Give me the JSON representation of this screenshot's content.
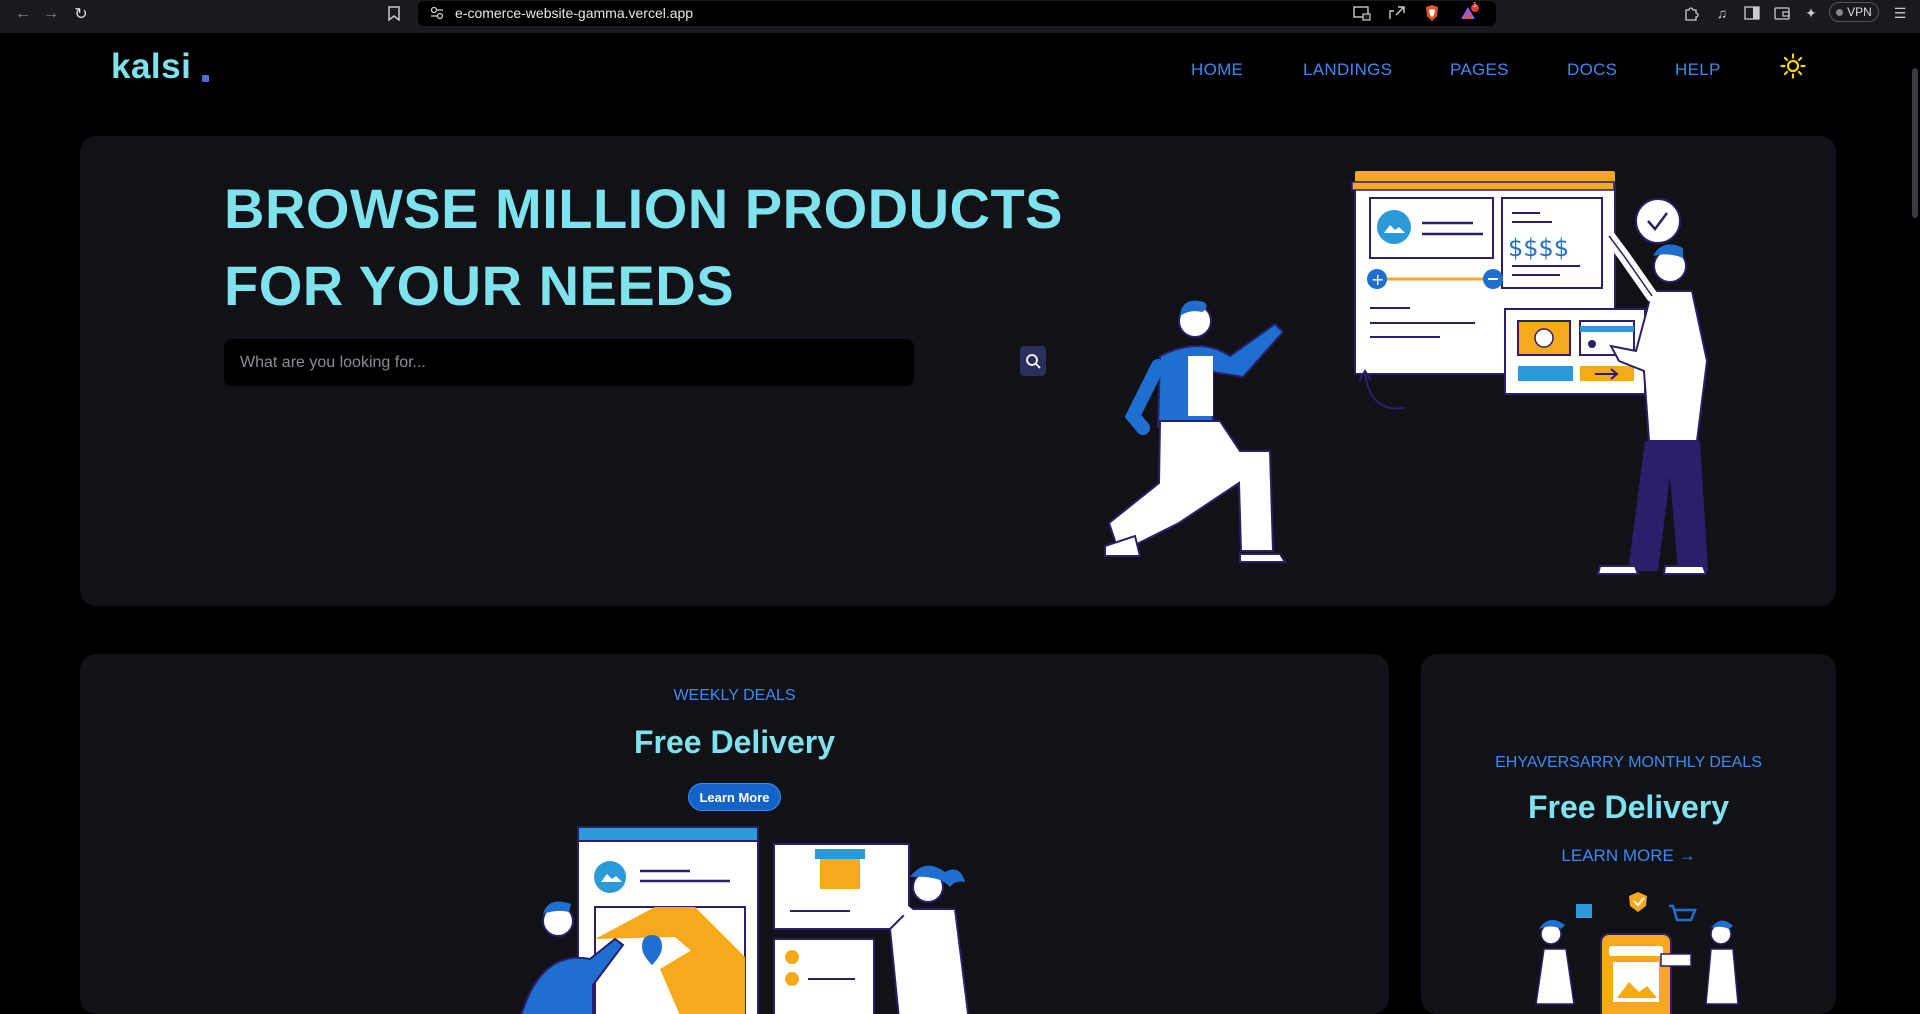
{
  "browser": {
    "url": "e-comerce-website-gamma.vercel.app",
    "vpn_label": "VPN",
    "notification_count": "1"
  },
  "site": {
    "logo": "kalsi",
    "nav": [
      "HOME",
      "LANDINGS",
      "PAGES",
      "DOCS",
      "HELP"
    ]
  },
  "hero": {
    "title_line1": "BROWSE MILLION PRODUCTS",
    "title_line2": "FOR YOUR NEEDS",
    "search_placeholder": "What are you looking for...",
    "price_text": "$$$$"
  },
  "weekly": {
    "eyebrow": "WEEKLY DEALS",
    "title": "Free Delivery",
    "button": "Learn More"
  },
  "monthly": {
    "eyebrow": "EHYAVERSARRY MONTHLY DEALS",
    "title": "Free Delivery",
    "link": "LEARN MORE"
  },
  "colors": {
    "accent_cyan": "#7fe3ee",
    "accent_blue": "#3b8bf3",
    "card_bg": "#111118",
    "orange": "#f6a91b"
  }
}
